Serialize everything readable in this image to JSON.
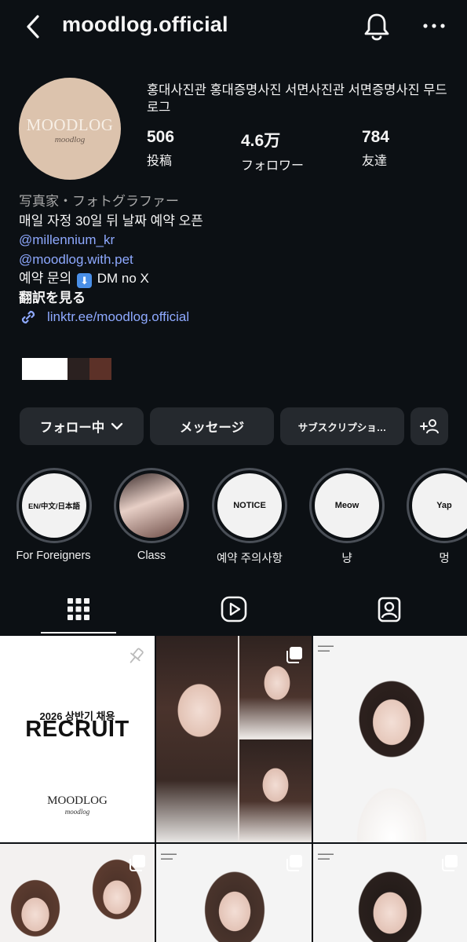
{
  "header": {
    "username": "moodlog.official"
  },
  "profile": {
    "avatar_brand": "MOODLOG",
    "avatar_script": "moodlog",
    "full_name": "홍대사진관 홍대증명사진 서면사진관 서면증명사진 무드로그",
    "stats": [
      {
        "value": "506",
        "label": "投稿"
      },
      {
        "value": "4.6万",
        "label": "フォロワー"
      },
      {
        "value": "784",
        "label": "友達"
      }
    ],
    "category": "写真家・フォトグラファー",
    "bio_line1": "매일 자정 30일 뒤 날짜 예약 오픈",
    "mention1": "@millennium_kr",
    "mention2": "@moodlog.with.pet",
    "bio_dm_prefix": "예약 문의",
    "bio_dm_suffix": "DM no X",
    "translate": "翻訳を見る",
    "link": "linktr.ee/moodlog.official",
    "swatch_colors": [
      "#ffffff",
      "#2b2120",
      "#5c3128"
    ]
  },
  "actions": {
    "following": "フォロー中",
    "message": "メッセージ",
    "subscription": "サブスクリプショ…"
  },
  "highlights": [
    {
      "cover": "EN/中文/日本語",
      "label": "For Foreigners"
    },
    {
      "cover": "",
      "label": "Class"
    },
    {
      "cover": "NOTICE",
      "label": "예약 주의사항"
    },
    {
      "cover": "Meow",
      "label": "냥"
    },
    {
      "cover": "Yap",
      "label": "멍"
    }
  ],
  "posts": {
    "recruit_sub": "2026 상반기 채용",
    "recruit_title": "RECRUIT",
    "recruit_brand": "MOODLOG",
    "recruit_script": "moodlog"
  },
  "colors": {
    "background": "#0c1014",
    "button": "#25292e",
    "link": "#8ea9ff"
  },
  "icons": [
    "back-icon",
    "bell-icon",
    "more-icon",
    "chevron-down-icon",
    "add-person-icon",
    "chain-link-icon",
    "grid-icon",
    "reels-icon",
    "tagged-icon",
    "pin-icon",
    "carousel-icon"
  ]
}
